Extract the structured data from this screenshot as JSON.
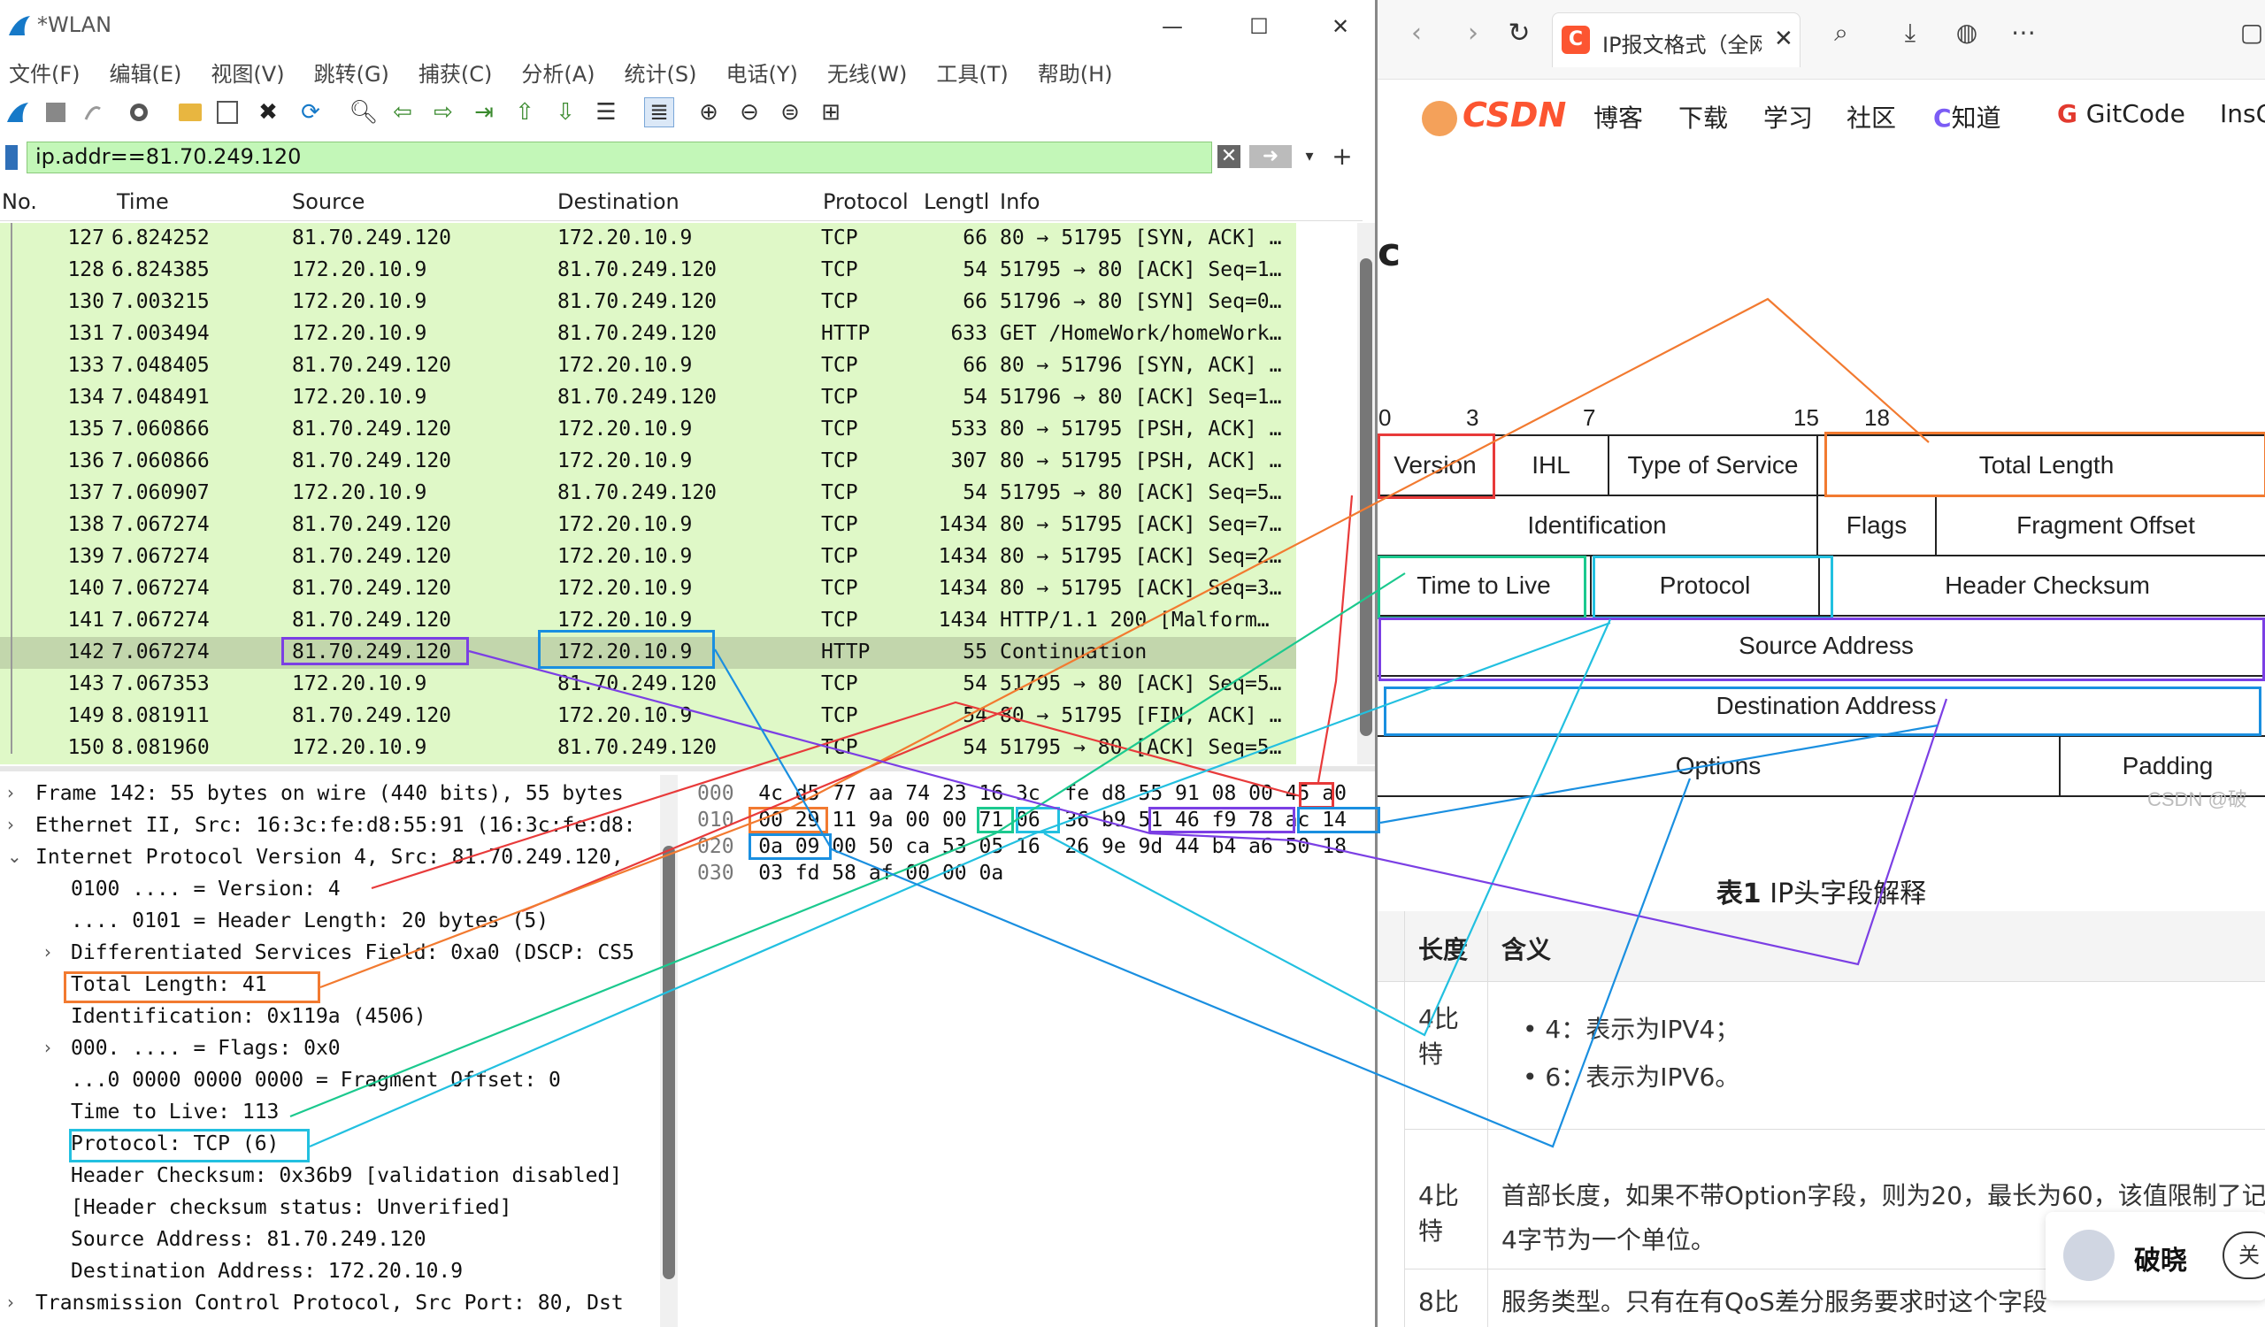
{
  "wireshark": {
    "title": "*WLAN",
    "window_controls": [
      "—",
      "☐",
      "✕"
    ],
    "menu": [
      "文件(F)",
      "编辑(E)",
      "视图(V)",
      "跳转(G)",
      "捕获(C)",
      "分析(A)",
      "统计(S)",
      "电话(Y)",
      "无线(W)",
      "工具(T)",
      "帮助(H)"
    ],
    "toolbar_icons": [
      "shark-fin-icon",
      "stop-icon",
      "restart-icon",
      "options-gear-icon",
      "open-folder-icon",
      "save-icon",
      "close-file-icon",
      "reload-icon",
      "find-icon",
      "back-arrow-icon",
      "forward-arrow-icon",
      "goto-packet-icon",
      "first-packet-icon",
      "last-packet-icon",
      "autoscroll-icon",
      "colorize-icon",
      "zoom-in-icon",
      "zoom-out-icon",
      "zoom-normal-icon",
      "resize-columns-icon"
    ],
    "filter": {
      "value": "ip.addr==81.70.249.120",
      "add_label": "+"
    },
    "columns": [
      "No.",
      "Time",
      "Source",
      "Destination",
      "Protocol",
      "Lengtl",
      "Info"
    ],
    "packets": [
      {
        "no": "127",
        "time": "6.824252",
        "src": "81.70.249.120",
        "dst": "172.20.10.9",
        "proto": "TCP",
        "len": "66",
        "info": "80 → 51795 [SYN, ACK] …"
      },
      {
        "no": "128",
        "time": "6.824385",
        "src": "172.20.10.9",
        "dst": "81.70.249.120",
        "proto": "TCP",
        "len": "54",
        "info": "51795 → 80 [ACK] Seq=1…"
      },
      {
        "no": "130",
        "time": "7.003215",
        "src": "172.20.10.9",
        "dst": "81.70.249.120",
        "proto": "TCP",
        "len": "66",
        "info": "51796 → 80 [SYN] Seq=0…"
      },
      {
        "no": "131",
        "time": "7.003494",
        "src": "172.20.10.9",
        "dst": "81.70.249.120",
        "proto": "HTTP",
        "len": "633",
        "info": "GET /HomeWork/homeWork…"
      },
      {
        "no": "133",
        "time": "7.048405",
        "src": "81.70.249.120",
        "dst": "172.20.10.9",
        "proto": "TCP",
        "len": "66",
        "info": "80 → 51796 [SYN, ACK] …"
      },
      {
        "no": "134",
        "time": "7.048491",
        "src": "172.20.10.9",
        "dst": "81.70.249.120",
        "proto": "TCP",
        "len": "54",
        "info": "51796 → 80 [ACK] Seq=1…"
      },
      {
        "no": "135",
        "time": "7.060866",
        "src": "81.70.249.120",
        "dst": "172.20.10.9",
        "proto": "TCP",
        "len": "533",
        "info": "80 → 51795 [PSH, ACK] …"
      },
      {
        "no": "136",
        "time": "7.060866",
        "src": "81.70.249.120",
        "dst": "172.20.10.9",
        "proto": "TCP",
        "len": "307",
        "info": "80 → 51795 [PSH, ACK] …"
      },
      {
        "no": "137",
        "time": "7.060907",
        "src": "172.20.10.9",
        "dst": "81.70.249.120",
        "proto": "TCP",
        "len": "54",
        "info": "51795 → 80 [ACK] Seq=5…"
      },
      {
        "no": "138",
        "time": "7.067274",
        "src": "81.70.249.120",
        "dst": "172.20.10.9",
        "proto": "TCP",
        "len": "1434",
        "info": "80 → 51795 [ACK] Seq=7…"
      },
      {
        "no": "139",
        "time": "7.067274",
        "src": "81.70.249.120",
        "dst": "172.20.10.9",
        "proto": "TCP",
        "len": "1434",
        "info": "80 → 51795 [ACK] Seq=2…"
      },
      {
        "no": "140",
        "time": "7.067274",
        "src": "81.70.249.120",
        "dst": "172.20.10.9",
        "proto": "TCP",
        "len": "1434",
        "info": "80 → 51795 [ACK] Seq=3…"
      },
      {
        "no": "141",
        "time": "7.067274",
        "src": "81.70.249.120",
        "dst": "172.20.10.9",
        "proto": "TCP",
        "len": "1434",
        "info": "HTTP/1.1 200  [Malform…"
      },
      {
        "no": "142",
        "time": "7.067274",
        "src": "81.70.249.120",
        "dst": "172.20.10.9",
        "proto": "HTTP",
        "len": "55",
        "info": "Continuation"
      },
      {
        "no": "143",
        "time": "7.067353",
        "src": "172.20.10.9",
        "dst": "81.70.249.120",
        "proto": "TCP",
        "len": "54",
        "info": "51795 → 80 [ACK] Seq=5…"
      },
      {
        "no": "149",
        "time": "8.081911",
        "src": "81.70.249.120",
        "dst": "172.20.10.9",
        "proto": "TCP",
        "len": "54",
        "info": "80 → 51795 [FIN, ACK] …"
      },
      {
        "no": "150",
        "time": "8.081960",
        "src": "172.20.10.9",
        "dst": "81.70.249.120",
        "proto": "TCP",
        "len": "54",
        "info": "51795 → 80 [ACK] Seq=5…"
      }
    ],
    "details": [
      {
        "text": "Frame 142: 55 bytes on wire (440 bits), 55 bytes",
        "arrow": "›"
      },
      {
        "text": "Ethernet II, Src: 16:3c:fe:d8:55:91 (16:3c:fe:d8:",
        "arrow": "›"
      },
      {
        "text": "Internet Protocol Version 4, Src: 81.70.249.120,",
        "arrow": "⌄"
      },
      {
        "text": "0100 .... = Version: 4",
        "arrow": ""
      },
      {
        "text": ".... 0101 = Header Length: 20 bytes (5)",
        "arrow": ""
      },
      {
        "text": "Differentiated Services Field: 0xa0 (DSCP: CS5",
        "arrow": "›"
      },
      {
        "text": "Total Length: 41",
        "arrow": ""
      },
      {
        "text": "Identification: 0x119a (4506)",
        "arrow": ""
      },
      {
        "text": "000. .... = Flags: 0x0",
        "arrow": "›"
      },
      {
        "text": "...0 0000 0000 0000 = Fragment Offset: 0",
        "arrow": ""
      },
      {
        "text": "Time to Live: 113",
        "arrow": ""
      },
      {
        "text": "Protocol: TCP (6)",
        "arrow": ""
      },
      {
        "text": "Header Checksum: 0x36b9 [validation disabled]",
        "arrow": ""
      },
      {
        "text": "[Header checksum status: Unverified]",
        "arrow": ""
      },
      {
        "text": "Source Address: 81.70.249.120",
        "arrow": ""
      },
      {
        "text": "Destination Address: 172.20.10.9",
        "arrow": ""
      },
      {
        "text": "Transmission Control Protocol, Src Port: 80, Dst",
        "arrow": "›"
      }
    ],
    "hex": [
      {
        "off": "000",
        "bytes": "4c d5 77 aa 74 23 16 3c  fe d8 55 91 08 00 45 a0"
      },
      {
        "off": "010",
        "bytes": "00 29 11 9a 00 00 71 06  36 b9 51 46 f9 78 ac 14"
      },
      {
        "off": "020",
        "bytes": "0a 09 00 50 ca 53 05 16  26 9e 9d 44 b4 a6 50 18"
      },
      {
        "off": "030",
        "bytes": "03 fd 58 af 00 00 0a"
      }
    ]
  },
  "browser": {
    "tab_title": "IP报文格式（全网",
    "tab_icon": "C",
    "nav_icons": [
      "back-icon",
      "forward-icon",
      "refresh-icon"
    ],
    "right_icons": [
      "search-icon",
      "download-icon",
      "globe-icon",
      "more-icon",
      "window-icon"
    ],
    "site": {
      "logo": "CSDN",
      "items": [
        "博客",
        "下载",
        "学习",
        "社区",
        "知道",
        "GitCode",
        "InsC"
      ]
    },
    "figure": {
      "partial_title": "c",
      "bit_numbers": [
        "0",
        "3",
        "7",
        "15",
        "18"
      ],
      "rows": [
        [
          "Version",
          "IHL",
          "Type of Service",
          "Total Length"
        ],
        [
          "Identification",
          "Flags",
          "Fragment Offset"
        ],
        [
          "Time to Live",
          "Protocol",
          "Header Checksum"
        ],
        [
          "Source Address"
        ],
        [
          "Destination Address"
        ],
        [
          "Options",
          "Padding"
        ]
      ],
      "watermark": "CSDN @破"
    },
    "caption": {
      "bold": "表1",
      "rest": " IP头字段解释"
    },
    "table": {
      "headers": [
        "长度",
        "含义"
      ],
      "rows": [
        {
          "len": "4比特",
          "meaning": [
            "4：表示为IPV4；",
            "6：表示为IPV6。"
          ]
        },
        {
          "len": "4比特",
          "meaning": [
            "首部长度，如果不带Option字段，则为20，最长为60，该值限制了记录",
            "4字节为一个单位。"
          ]
        },
        {
          "len": "8比",
          "meaning": [
            "服务类型。只有在有QoS差分服务要求时这个字段"
          ]
        }
      ]
    },
    "author": {
      "name": "破晓",
      "follow": "关"
    }
  }
}
